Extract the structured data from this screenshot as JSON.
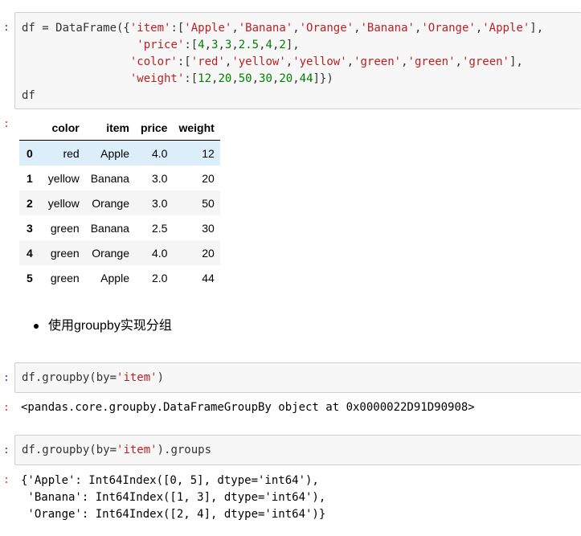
{
  "prompts": {
    "in": ":",
    "out": ":"
  },
  "cell1": {
    "lines": [
      [
        {
          "t": "df = DataFrame({",
          "c": ""
        },
        {
          "t": "'item'",
          "c": "s"
        },
        {
          "t": ":[",
          "c": ""
        },
        {
          "t": "'Apple'",
          "c": "s"
        },
        {
          "t": ",",
          "c": ""
        },
        {
          "t": "'Banana'",
          "c": "s"
        },
        {
          "t": ",",
          "c": ""
        },
        {
          "t": "'Orange'",
          "c": "s"
        },
        {
          "t": ",",
          "c": ""
        },
        {
          "t": "'Banana'",
          "c": "s"
        },
        {
          "t": ",",
          "c": ""
        },
        {
          "t": "'Orange'",
          "c": "s"
        },
        {
          "t": ",",
          "c": ""
        },
        {
          "t": "'Apple'",
          "c": "s"
        },
        {
          "t": "],",
          "c": ""
        }
      ],
      [
        {
          "t": "                 ",
          "c": ""
        },
        {
          "t": "'price'",
          "c": "s"
        },
        {
          "t": ":[",
          "c": ""
        },
        {
          "t": "4",
          "c": "n"
        },
        {
          "t": ",",
          "c": ""
        },
        {
          "t": "3",
          "c": "n"
        },
        {
          "t": ",",
          "c": ""
        },
        {
          "t": "3",
          "c": "n"
        },
        {
          "t": ",",
          "c": ""
        },
        {
          "t": "2.5",
          "c": "n"
        },
        {
          "t": ",",
          "c": ""
        },
        {
          "t": "4",
          "c": "n"
        },
        {
          "t": ",",
          "c": ""
        },
        {
          "t": "2",
          "c": "n"
        },
        {
          "t": "],",
          "c": ""
        }
      ],
      [
        {
          "t": "                ",
          "c": ""
        },
        {
          "t": "'color'",
          "c": "s"
        },
        {
          "t": ":[",
          "c": ""
        },
        {
          "t": "'red'",
          "c": "s"
        },
        {
          "t": ",",
          "c": ""
        },
        {
          "t": "'yellow'",
          "c": "s"
        },
        {
          "t": ",",
          "c": ""
        },
        {
          "t": "'yellow'",
          "c": "s"
        },
        {
          "t": ",",
          "c": ""
        },
        {
          "t": "'green'",
          "c": "s"
        },
        {
          "t": ",",
          "c": ""
        },
        {
          "t": "'green'",
          "c": "s"
        },
        {
          "t": ",",
          "c": ""
        },
        {
          "t": "'green'",
          "c": "s"
        },
        {
          "t": "],",
          "c": ""
        }
      ],
      [
        {
          "t": "                ",
          "c": ""
        },
        {
          "t": "'weight'",
          "c": "s"
        },
        {
          "t": ":[",
          "c": ""
        },
        {
          "t": "12",
          "c": "n"
        },
        {
          "t": ",",
          "c": ""
        },
        {
          "t": "20",
          "c": "n"
        },
        {
          "t": ",",
          "c": ""
        },
        {
          "t": "50",
          "c": "n"
        },
        {
          "t": ",",
          "c": ""
        },
        {
          "t": "30",
          "c": "n"
        },
        {
          "t": ",",
          "c": ""
        },
        {
          "t": "20",
          "c": "n"
        },
        {
          "t": ",",
          "c": ""
        },
        {
          "t": "44",
          "c": "n"
        },
        {
          "t": "]})",
          "c": ""
        }
      ],
      [
        {
          "t": "df",
          "c": ""
        }
      ]
    ]
  },
  "table": {
    "columns": [
      "color",
      "item",
      "price",
      "weight"
    ],
    "rows": [
      {
        "index": "0",
        "cells": [
          "red",
          "Apple",
          "4.0",
          "12"
        ]
      },
      {
        "index": "1",
        "cells": [
          "yellow",
          "Banana",
          "3.0",
          "20"
        ]
      },
      {
        "index": "2",
        "cells": [
          "yellow",
          "Orange",
          "3.0",
          "50"
        ]
      },
      {
        "index": "3",
        "cells": [
          "green",
          "Banana",
          "2.5",
          "30"
        ]
      },
      {
        "index": "4",
        "cells": [
          "green",
          "Orange",
          "4.0",
          "20"
        ]
      },
      {
        "index": "5",
        "cells": [
          "green",
          "Apple",
          "2.0",
          "44"
        ]
      }
    ]
  },
  "markdown": {
    "bullet_text": "使用groupby实现分组"
  },
  "cell2": {
    "lines": [
      [
        {
          "t": "df.groupby(by=",
          "c": ""
        },
        {
          "t": "'item'",
          "c": "s"
        },
        {
          "t": ")",
          "c": ""
        }
      ]
    ],
    "output": "<pandas.core.groupby.DataFrameGroupBy object at 0x0000022D91D90908>"
  },
  "cell3": {
    "lines": [
      [
        {
          "t": "df.groupby(by=",
          "c": ""
        },
        {
          "t": "'item'",
          "c": "s"
        },
        {
          "t": ").groups",
          "c": ""
        }
      ]
    ],
    "output": "{'Apple': Int64Index([0, 5], dtype='int64'),\n 'Banana': Int64Index([1, 3], dtype='int64'),\n 'Orange': Int64Index([2, 4], dtype='int64')}"
  }
}
